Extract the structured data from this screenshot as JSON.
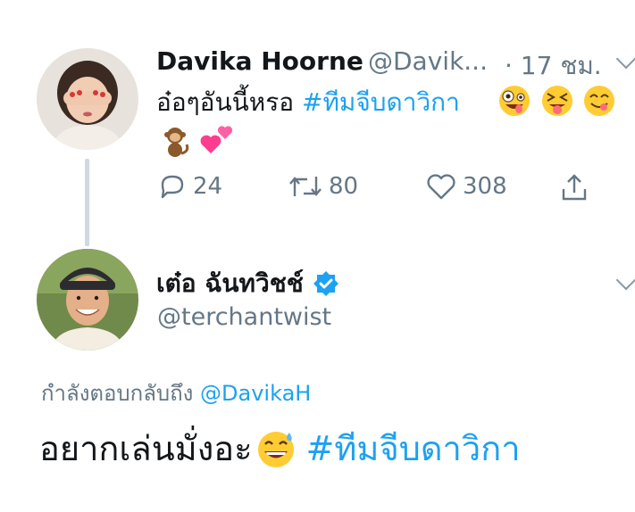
{
  "tweet": {
    "name": "Davika Hoorne",
    "handle": "@Davik...",
    "time": "· 17 ชม.",
    "text": "อ๋อๆอันนี้หรอ",
    "hashtag": "#ทีมจีบดาวิกา",
    "emojis": [
      "zany-face-emoji",
      "squinting-tongue-face-emoji",
      "yum-face-emoji",
      "monkey-emoji",
      "two-hearts-emoji"
    ],
    "replies": "24",
    "retweets": "80",
    "likes": "308"
  },
  "reply": {
    "name": "เต๋อ ฉันทวิชช์",
    "handle": "@terchantwist",
    "verified": true,
    "replying_to_label": "กำลังตอบกลับถึง",
    "replying_to_handle": "@DavikaH",
    "text": "อยากเล่นมั่งอะ",
    "hashtag": "#ทีมจีบดาวิกา",
    "emoji": "sweat-smile-emoji"
  },
  "colors": {
    "link": "#1da1f2",
    "secondary_text": "#657786",
    "thread_line": "#cfd9de",
    "verified": "#1da1f2"
  }
}
